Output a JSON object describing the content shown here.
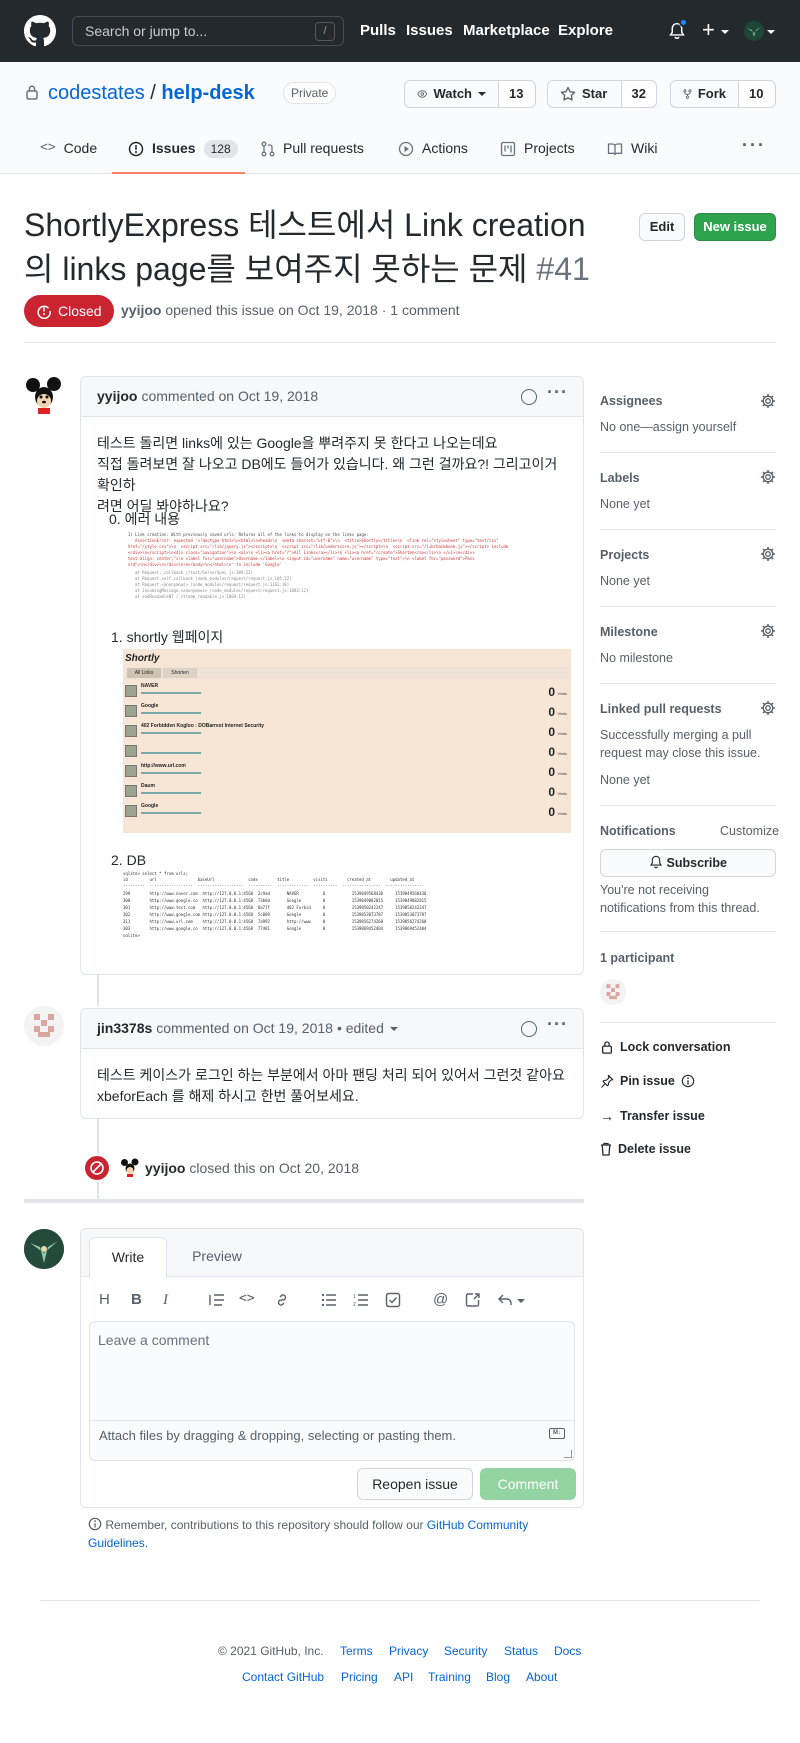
{
  "header": {
    "search_placeholder": "Search or jump to...",
    "slash_key": "/",
    "nav": [
      "Pulls",
      "Issues",
      "Marketplace",
      "Explore"
    ]
  },
  "repo": {
    "owner": "codestates",
    "separator": "/",
    "name": "help-desk",
    "visibility": "Private",
    "watch_label": "Watch",
    "watch_count": "13",
    "star_label": "Star",
    "star_count": "32",
    "fork_label": "Fork",
    "fork_count": "10"
  },
  "tabs": [
    {
      "label": "Code",
      "icon": "code-icon"
    },
    {
      "label": "Issues",
      "icon": "issue-opened-icon",
      "count": "128",
      "selected": true
    },
    {
      "label": "Pull requests",
      "icon": "git-pull-request-icon"
    },
    {
      "label": "Actions",
      "icon": "play-icon"
    },
    {
      "label": "Projects",
      "icon": "project-icon"
    },
    {
      "label": "Wiki",
      "icon": "book-icon"
    }
  ],
  "issue": {
    "title": "ShortlyExpress 테스트에서 Link creation의 links page를 보여주지 못하는 문제",
    "number": "#41",
    "edit_label": "Edit",
    "new_issue_label": "New issue",
    "state": "Closed",
    "author": "yyijoo",
    "meta_text": "opened this issue on Oct 19, 2018 · 1 comment"
  },
  "comments": [
    {
      "author": "yyijoo",
      "action": "commented on Oct 19, 2018",
      "body_lines": [
        "테스트 돌리면 links에 있는 Google을 뿌려주지 못 한다고 나오는데요",
        "직접 돌려보면 잘 나오고 DB에도 들어가 있습니다. 왜 그런 걸까요?! 그리고이거 확인하",
        "려면 어딜 봐야하나요?"
      ],
      "list": [
        {
          "marker": "0.",
          "text": "에러 내용"
        },
        {
          "marker": "1.",
          "text": "shortly 웹페이지"
        },
        {
          "marker": "2.",
          "text": "DB"
        }
      ]
    },
    {
      "author": "jin3378s",
      "action": "commented on Oct 19, 2018",
      "edited": "• edited",
      "body_lines": [
        "테스트 케이스가 로그인 하는 부분에서 아마 팬딩 처리 되어 있어서 그런것 같아요",
        "xbeforEach 를 해제 하시고 한번 풀어보세요."
      ]
    }
  ],
  "closed_event": {
    "actor": "yyijoo",
    "text": "closed this on Oct 20, 2018"
  },
  "shortly_mock": {
    "brand": "Shortly",
    "tabs": [
      "All Links",
      "Shorten"
    ],
    "rows": [
      {
        "title": "NAVER",
        "count": "0"
      },
      {
        "title": "Google",
        "count": "0"
      },
      {
        "title": "402 Forbidden Kogloo : DOBarrest Internet Security",
        "count": "0"
      },
      {
        "title": "",
        "count": "0"
      },
      {
        "title": "http://www.url.com",
        "count": "0"
      },
      {
        "title": "Daum",
        "count": "0"
      },
      {
        "title": "Google",
        "count": "0"
      }
    ],
    "visits_label": "Visits"
  },
  "composer": {
    "write_tab": "Write",
    "preview_tab": "Preview",
    "placeholder": "Leave a comment",
    "attach_text": "Attach files by dragging & dropping, selecting or pasting them.",
    "reopen_label": "Reopen issue",
    "comment_label": "Comment",
    "toolbar_icons": [
      "heading-icon",
      "bold-icon",
      "italic-icon",
      "quote-icon",
      "code-icon",
      "link-icon",
      "unordered-list-icon",
      "ordered-list-icon",
      "tasklist-icon",
      "mention-icon",
      "cross-reference-icon",
      "reply-icon"
    ],
    "notice": "Remember, contributions to this repository should follow our",
    "notice_link": "GitHub Community Guidelines",
    "notice_end": "."
  },
  "sidebar": {
    "assignees_label": "Assignees",
    "assignees_value": "No one—assign yourself",
    "labels_label": "Labels",
    "labels_value": "None yet",
    "projects_label": "Projects",
    "projects_value": "None yet",
    "milestone_label": "Milestone",
    "milestone_value": "No milestone",
    "linked_label": "Linked pull requests",
    "linked_desc": "Successfully merging a pull request may close this issue.",
    "linked_value": "None yet",
    "notifications_label": "Notifications",
    "customize_label": "Customize",
    "subscribe_label": "Subscribe",
    "notif_desc": "You're not receiving notifications from this thread.",
    "participants_label": "1 participant",
    "lock_label": "Lock conversation",
    "pin_label": "Pin issue",
    "transfer_label": "Transfer issue",
    "delete_label": "Delete issue"
  },
  "footer": {
    "copyright": "© 2021 GitHub, Inc.",
    "row1": [
      "Terms",
      "Privacy",
      "Security",
      "Status",
      "Docs"
    ],
    "row2": [
      "Contact GitHub",
      "Pricing",
      "API",
      "Training",
      "Blog",
      "About"
    ]
  },
  "colors": {
    "header_bg": "#24292e",
    "closed_red": "#cb2431",
    "green": "#2ea44f",
    "link_blue": "#0366d6",
    "tab_underline": "#f9826c"
  }
}
